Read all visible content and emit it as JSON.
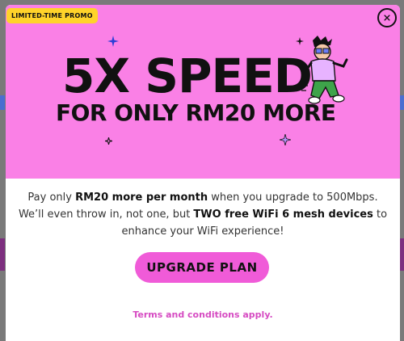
{
  "badge": "LIMITED-TIME PROMO",
  "headline": "5X SPEED",
  "subheadline": "FOR ONLY RM20 MORE",
  "body": {
    "p1": "Pay only ",
    "b1": "RM20 more per month",
    "p2": " when you upgrade to 500Mbps. We’ll even throw in, not one, but ",
    "b2": "TWO free WiFi 6 mesh devices",
    "p3": " to enhance your WiFi experience!"
  },
  "cta_label": "UPGRADE PLAN",
  "terms_link": "Terms and conditions apply",
  "terms_period": ".",
  "colors": {
    "hero_bg": "#fa80e6",
    "badge_bg": "#ffd32a",
    "cta_bg": "#f05bd8",
    "link": "#d64bc2"
  },
  "icons": [
    "close-icon",
    "sparkle-icon",
    "mascot-illustration"
  ]
}
